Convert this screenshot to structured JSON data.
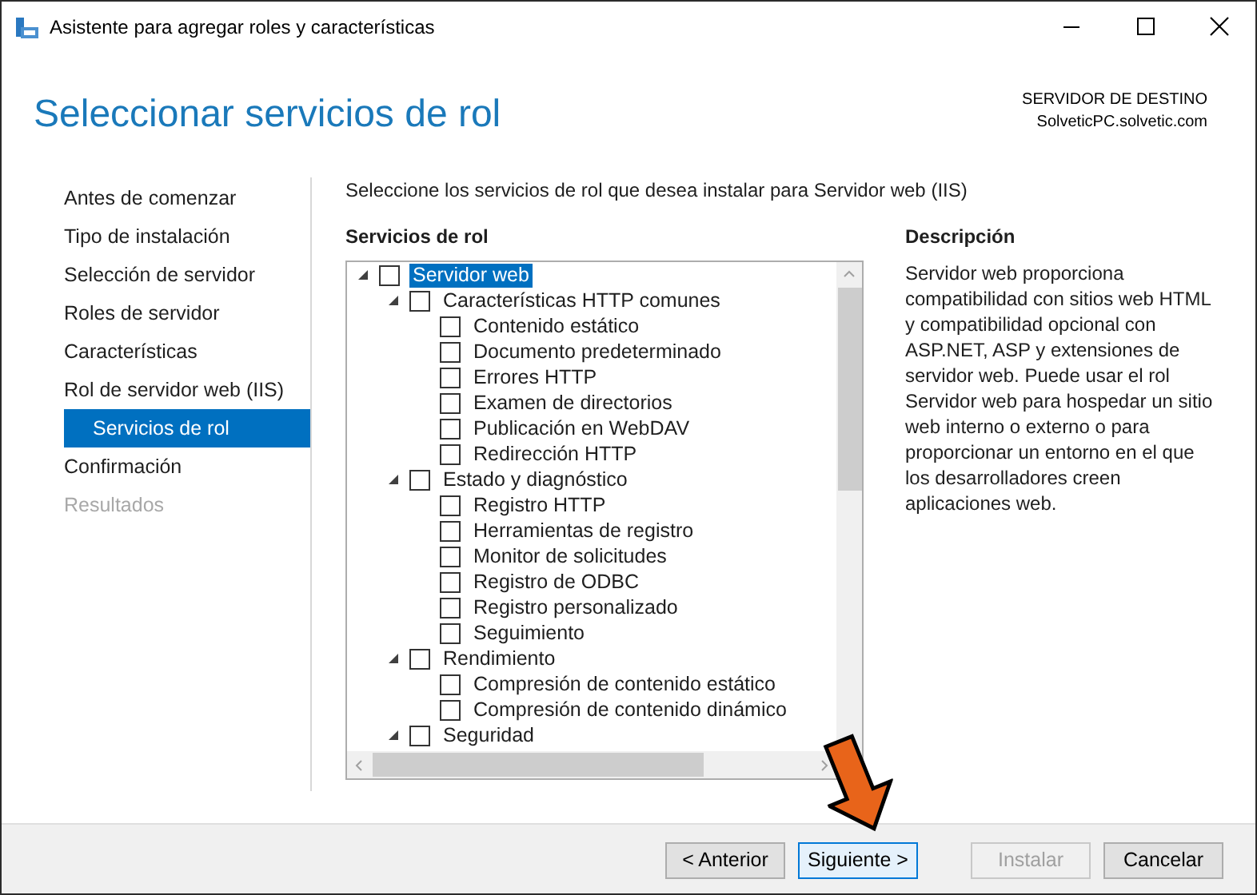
{
  "window": {
    "title": "Asistente para agregar roles y características"
  },
  "header": {
    "title": "Seleccionar servicios de rol",
    "server_label": "SERVIDOR DE DESTINO",
    "server_name": "SolveticPC.solvetic.com"
  },
  "nav": [
    {
      "label": "Antes de comenzar",
      "selected": false,
      "disabled": false
    },
    {
      "label": "Tipo de instalación",
      "selected": false,
      "disabled": false
    },
    {
      "label": "Selección de servidor",
      "selected": false,
      "disabled": false
    },
    {
      "label": "Roles de servidor",
      "selected": false,
      "disabled": false
    },
    {
      "label": "Características",
      "selected": false,
      "disabled": false
    },
    {
      "label": "Rol de servidor web (IIS)",
      "selected": false,
      "disabled": false,
      "children": [
        {
          "label": "Servicios de rol",
          "selected": true,
          "disabled": false
        }
      ]
    },
    {
      "label": "Confirmación",
      "selected": false,
      "disabled": false
    },
    {
      "label": "Resultados",
      "selected": false,
      "disabled": true
    }
  ],
  "instruction": "Seleccione los servicios de rol que desea instalar para Servidor web (IIS)",
  "tree_heading": "Servicios de rol",
  "tree": [
    {
      "label": "Servidor web",
      "checked": false,
      "selected": true,
      "expanded": true,
      "children": [
        {
          "label": "Características HTTP comunes",
          "checked": false,
          "selected": false,
          "expanded": true,
          "children": [
            {
              "label": "Contenido estático",
              "checked": false,
              "selected": false
            },
            {
              "label": "Documento predeterminado",
              "checked": false,
              "selected": false
            },
            {
              "label": "Errores HTTP",
              "checked": false,
              "selected": false
            },
            {
              "label": "Examen de directorios",
              "checked": false,
              "selected": false
            },
            {
              "label": "Publicación en WebDAV",
              "checked": false,
              "selected": false
            },
            {
              "label": "Redirección HTTP",
              "checked": false,
              "selected": false
            }
          ]
        },
        {
          "label": "Estado y diagnóstico",
          "checked": false,
          "selected": false,
          "expanded": true,
          "children": [
            {
              "label": "Registro HTTP",
              "checked": false,
              "selected": false
            },
            {
              "label": "Herramientas de registro",
              "checked": false,
              "selected": false
            },
            {
              "label": "Monitor de solicitudes",
              "checked": false,
              "selected": false
            },
            {
              "label": "Registro de ODBC",
              "checked": false,
              "selected": false
            },
            {
              "label": "Registro personalizado",
              "checked": false,
              "selected": false
            },
            {
              "label": "Seguimiento",
              "checked": false,
              "selected": false
            }
          ]
        },
        {
          "label": "Rendimiento",
          "checked": false,
          "selected": false,
          "expanded": true,
          "children": [
            {
              "label": "Compresión de contenido estático",
              "checked": false,
              "selected": false
            },
            {
              "label": "Compresión de contenido dinámico",
              "checked": false,
              "selected": false
            }
          ]
        },
        {
          "label": "Seguridad",
          "checked": false,
          "selected": false,
          "expanded": true
        }
      ]
    }
  ],
  "description": {
    "heading": "Descripción",
    "text": "Servidor web proporciona compatibilidad con sitios web HTML y compatibilidad opcional con ASP.NET, ASP y extensiones de servidor web. Puede usar el rol Servidor web para hospedar un sitio web interno o externo o para proporcionar un entorno en el que los desarrolladores creen aplicaciones web."
  },
  "buttons": [
    {
      "label": "< Anterior",
      "default": false,
      "disabled": false
    },
    {
      "label": "Siguiente >",
      "default": true,
      "disabled": false
    },
    {
      "label": "Instalar",
      "default": false,
      "disabled": true
    },
    {
      "label": "Cancelar",
      "default": false,
      "disabled": false
    }
  ]
}
